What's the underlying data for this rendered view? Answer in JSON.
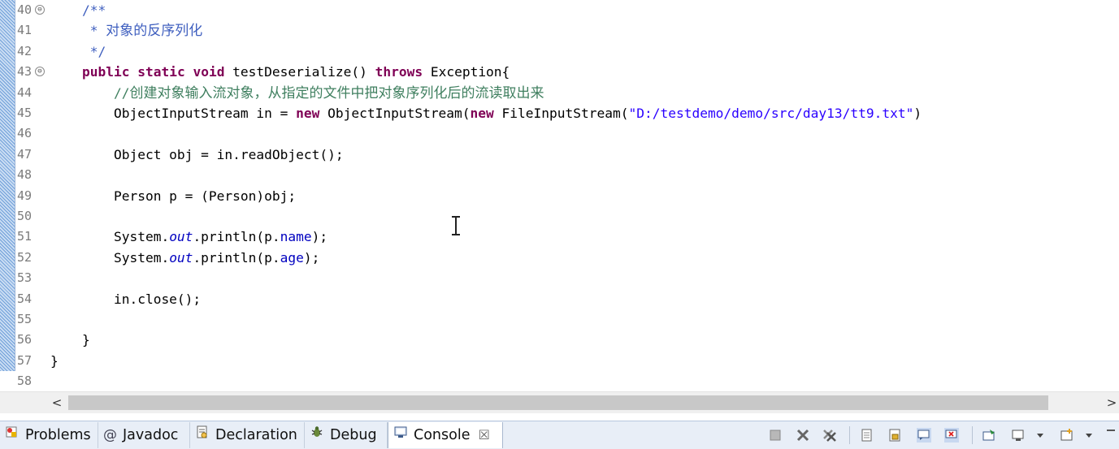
{
  "editor": {
    "lines": [
      {
        "num": "40",
        "fold": "⊖",
        "tokens": [
          [
            "cm",
            "    /**"
          ]
        ]
      },
      {
        "num": "41",
        "fold": "",
        "tokens": [
          [
            "cm",
            "     * "
          ],
          [
            "cm cjk",
            "对象的反序列化"
          ]
        ]
      },
      {
        "num": "42",
        "fold": "",
        "tokens": [
          [
            "cm",
            "     */"
          ]
        ]
      },
      {
        "num": "43",
        "fold": "⊖",
        "tokens": [
          [
            "",
            "    "
          ],
          [
            "kw",
            "public"
          ],
          [
            "",
            " "
          ],
          [
            "kw",
            "static"
          ],
          [
            "",
            " "
          ],
          [
            "kw",
            "void"
          ],
          [
            "",
            " testDeserialize() "
          ],
          [
            "kw",
            "throws"
          ],
          [
            "",
            " Exception{"
          ]
        ]
      },
      {
        "num": "44",
        "fold": "",
        "tokens": [
          [
            "",
            "        "
          ],
          [
            "cmc",
            "//"
          ],
          [
            "cmc cjk",
            "创建对象输入流对象，从指定的文件中把对象序列化后的流读取出来"
          ]
        ]
      },
      {
        "num": "45",
        "fold": "",
        "tokens": [
          [
            "",
            "        ObjectInputStream in = "
          ],
          [
            "kw",
            "new"
          ],
          [
            "",
            " ObjectInputStream("
          ],
          [
            "kw",
            "new"
          ],
          [
            "",
            " FileInputStream("
          ],
          [
            "str",
            "\"D:/testdemo/demo/src/day13/tt9.txt\""
          ],
          [
            "",
            ")"
          ]
        ]
      },
      {
        "num": "46",
        "fold": "",
        "tokens": []
      },
      {
        "num": "47",
        "fold": "",
        "tokens": [
          [
            "",
            "        Object obj = in.readObject();"
          ]
        ]
      },
      {
        "num": "48",
        "fold": "",
        "tokens": []
      },
      {
        "num": "49",
        "fold": "",
        "tokens": [
          [
            "",
            "        Person p = (Person)obj;"
          ]
        ]
      },
      {
        "num": "50",
        "fold": "",
        "tokens": []
      },
      {
        "num": "51",
        "fold": "",
        "tokens": [
          [
            "",
            "        System."
          ],
          [
            "sfld",
            "out"
          ],
          [
            "",
            ".println(p."
          ],
          [
            "fld",
            "name"
          ],
          [
            "",
            ");"
          ]
        ]
      },
      {
        "num": "52",
        "fold": "",
        "tokens": [
          [
            "",
            "        System."
          ],
          [
            "sfld",
            "out"
          ],
          [
            "",
            ".println(p."
          ],
          [
            "fld",
            "age"
          ],
          [
            "",
            ");"
          ]
        ]
      },
      {
        "num": "53",
        "fold": "",
        "tokens": []
      },
      {
        "num": "54",
        "fold": "",
        "tokens": [
          [
            "",
            "        in.close();"
          ]
        ]
      },
      {
        "num": "55",
        "fold": "",
        "tokens": []
      },
      {
        "num": "56",
        "fold": "",
        "tokens": [
          [
            "",
            "    }"
          ]
        ]
      },
      {
        "num": "57",
        "fold": "",
        "tokens": [
          [
            "",
            "}"
          ]
        ]
      },
      {
        "num": "58",
        "fold": "",
        "tokens": []
      }
    ]
  },
  "scrollbar": {
    "left_arrow": "<",
    "right_arrow": ">"
  },
  "tabs": [
    {
      "label": "Problems",
      "icon": "problems-icon",
      "active": false
    },
    {
      "label": "Javadoc",
      "icon": "at-icon",
      "active": false
    },
    {
      "label": "Declaration",
      "icon": "declaration-icon",
      "active": false
    },
    {
      "label": "Debug",
      "icon": "bug-icon",
      "active": false
    },
    {
      "label": "Console",
      "icon": "console-icon",
      "active": true
    }
  ],
  "toolbar_icons": [
    "terminate-icon",
    "remove-launch-icon",
    "remove-all-icon",
    "clear-console-icon",
    "scroll-lock-icon",
    "show-stdout-icon",
    "show-stderr-icon",
    "pin-console-icon",
    "display-console-icon",
    "display-dropdown-icon",
    "open-console-icon",
    "open-dropdown-icon",
    "minimize-icon"
  ]
}
